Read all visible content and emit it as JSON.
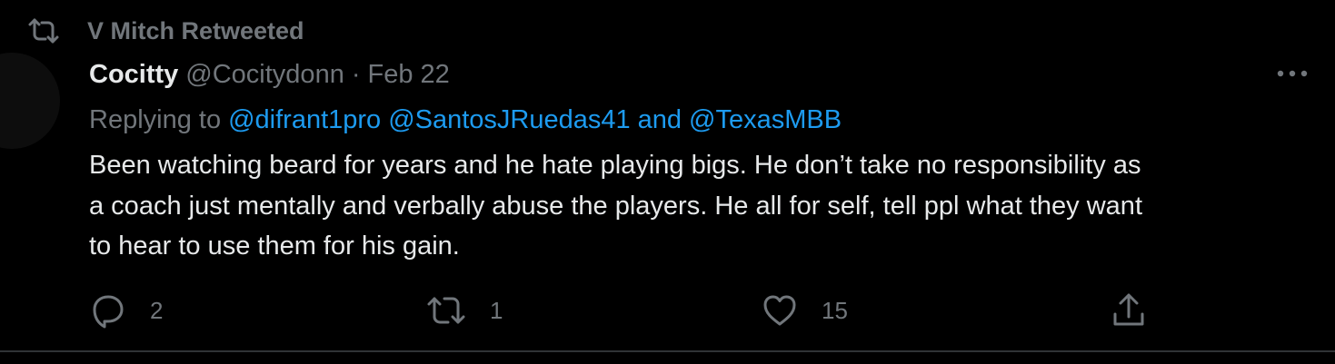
{
  "retweet_context": {
    "icon": "retweet-icon",
    "label": "V Mitch Retweeted"
  },
  "tweet": {
    "display_name": "Cocitty",
    "handle": "@Cocitydonn",
    "separator": "·",
    "date": "Feb 22",
    "more_icon": "more-dots-icon",
    "replying": {
      "prefix": "Replying to",
      "mention_1": "@difrant1pro",
      "mention_2": "@SantosJRuedas41",
      "conjunction": "and",
      "mention_3": "@TexasMBB"
    },
    "text_lines": [
      "Been watching beard for years and he hate playing bigs. He don’t take no responsibility as",
      "a coach just mentally and verbally abuse the players. He all for self, tell ppl what they want",
      "to hear to use them for his gain."
    ],
    "actions": {
      "reply": {
        "icon": "reply-icon",
        "count": "2"
      },
      "retweet": {
        "icon": "retweet-icon",
        "count": "1"
      },
      "like": {
        "icon": "heart-icon",
        "count": "15"
      },
      "share": {
        "icon": "share-icon"
      }
    }
  },
  "colors": {
    "background": "#000000",
    "primary_text": "#e7e9ea",
    "secondary_text": "#71767b",
    "link": "#1d9bf0",
    "divider": "#2f3336"
  }
}
